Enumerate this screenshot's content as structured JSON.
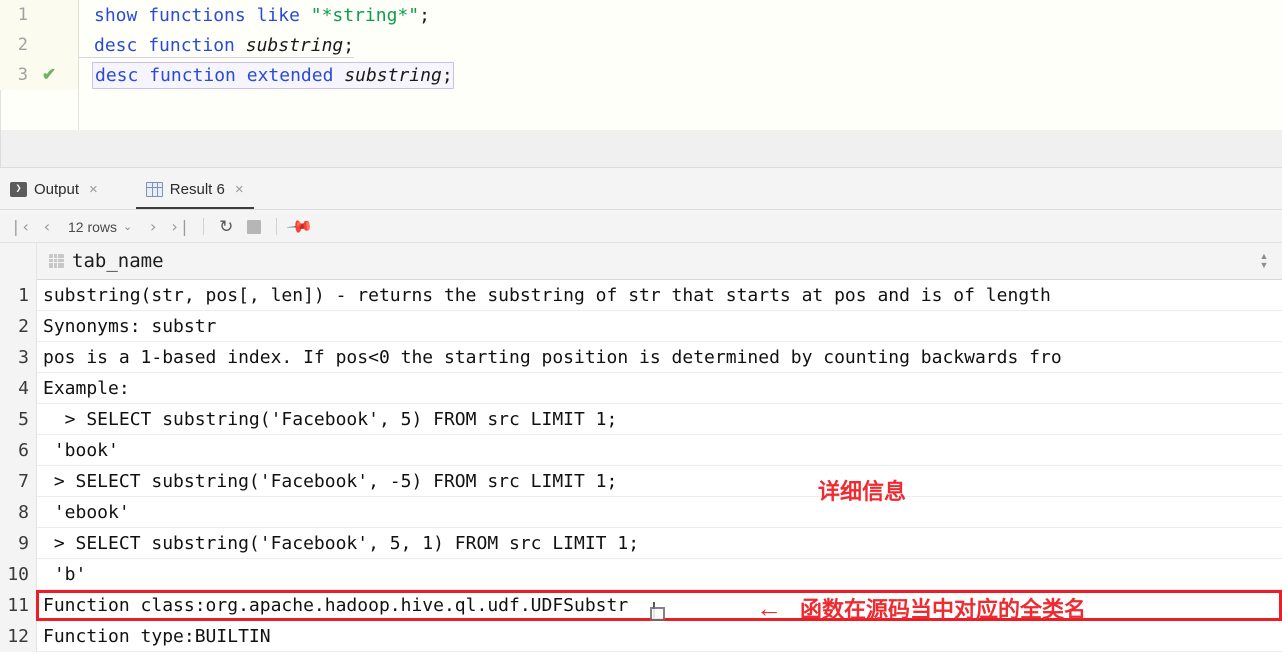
{
  "editor": {
    "lines": [
      {
        "number": "1",
        "status": "",
        "tokens": [
          {
            "t": "show ",
            "c": "kw"
          },
          {
            "t": "functions ",
            "c": "kw"
          },
          {
            "t": "like ",
            "c": "kw"
          },
          {
            "t": "\"*string*\"",
            "c": "str"
          },
          {
            "t": ";",
            "c": "punc"
          }
        ],
        "plain": "show functions like \"*string*\";"
      },
      {
        "number": "2",
        "status": "",
        "tokens": [
          {
            "t": "desc ",
            "c": "kw"
          },
          {
            "t": "function ",
            "c": "kw"
          },
          {
            "t": "substring",
            "c": "ital"
          },
          {
            "t": ";",
            "c": "punc"
          }
        ],
        "plain": "desc function substring;"
      },
      {
        "number": "3",
        "status": "check",
        "tokens": [
          {
            "t": "desc ",
            "c": "kw"
          },
          {
            "t": "function ",
            "c": "kw"
          },
          {
            "t": "extended ",
            "c": "kw"
          },
          {
            "t": "substring",
            "c": "ital"
          },
          {
            "t": ";",
            "c": "punc"
          }
        ],
        "plain": "desc function extended substring;"
      }
    ],
    "check_glyph": "✔"
  },
  "tabs": [
    {
      "label": "Output",
      "icon": "console-icon",
      "icon_glyph": "❯",
      "close": "×",
      "active": false
    },
    {
      "label": "Result 6",
      "icon": "table-grid-icon",
      "close": "×",
      "active": true
    }
  ],
  "toolbar": {
    "first_page": "❘‹",
    "prev_page": "‹",
    "rows_label": "12 rows",
    "rows_caret": "⌄",
    "next_page": "›",
    "last_page": "›❘",
    "refresh": "↻",
    "stop": "",
    "pin": "📌"
  },
  "grid": {
    "column_header": "tab_name",
    "sort_up": "▲",
    "sort_down": "▼",
    "rows": [
      {
        "n": "1",
        "value": "substring(str, pos[, len]) - returns the substring of str that starts at pos and is of length",
        "boxed": false
      },
      {
        "n": "2",
        "value": "Synonyms: substr",
        "boxed": false
      },
      {
        "n": "3",
        "value": "pos is a 1-based index. If pos<0 the starting position is determined by counting backwards fro",
        "boxed": false
      },
      {
        "n": "4",
        "value": "Example:",
        "boxed": false
      },
      {
        "n": "5",
        "value": "  > SELECT substring('Facebook', 5) FROM src LIMIT 1;",
        "boxed": false
      },
      {
        "n": "6",
        "value": " 'book'",
        "boxed": false
      },
      {
        "n": "7",
        "value": " > SELECT substring('Facebook', -5) FROM src LIMIT 1;",
        "boxed": false
      },
      {
        "n": "8",
        "value": " 'ebook'",
        "boxed": false
      },
      {
        "n": "9",
        "value": " > SELECT substring('Facebook', 5, 1) FROM src LIMIT 1;",
        "boxed": false
      },
      {
        "n": "10",
        "value": " 'b'",
        "boxed": false
      },
      {
        "n": "11",
        "value": "Function class:org.apache.hadoop.hive.ql.udf.UDFSubstr",
        "boxed": true
      },
      {
        "n": "12",
        "value": "Function type:BUILTIN",
        "boxed": false
      }
    ]
  },
  "annotations": {
    "detail_note": "详细信息",
    "class_note": "函数在源码当中对应的全类名",
    "arrow": "←"
  },
  "colors": {
    "annotation_red": "#ee2b30",
    "box_red": "#ee1c25",
    "keyword_blue": "#2b4ad6",
    "string_green": "#0e9e4a",
    "check_green": "#72b362",
    "active_tab_underline": "#3c3c3c"
  }
}
